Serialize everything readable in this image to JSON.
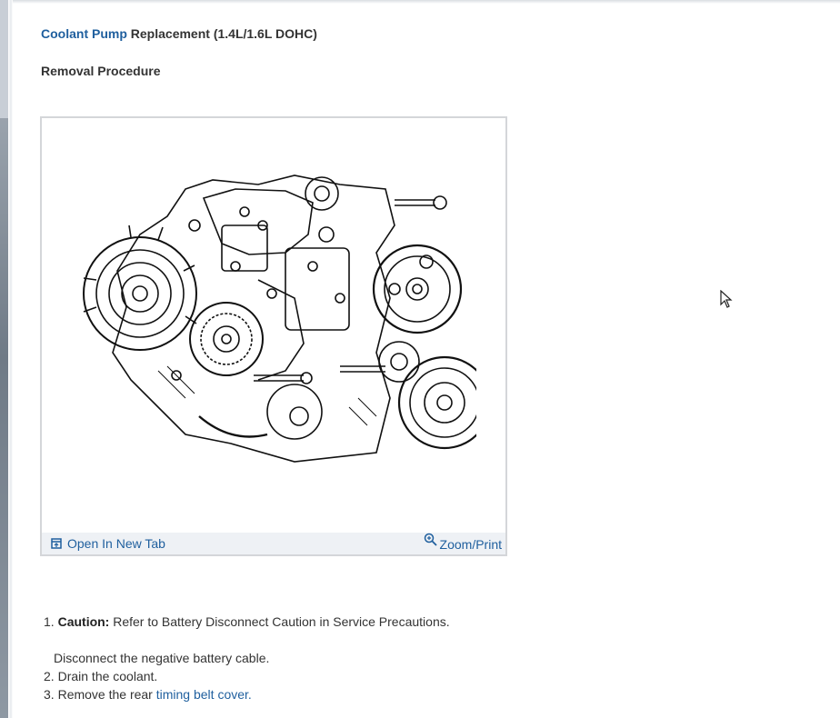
{
  "header": {
    "title_link": "Coolant Pump",
    "title_rest": " Replacement (1.4L/1.6L DOHC)",
    "subtitle": "Removal Procedure"
  },
  "figure": {
    "open_tab_label": "Open In New Tab",
    "zoom_label": "Zoom/Print",
    "icons": [
      "open-new-tab-icon",
      "zoom-icon"
    ]
  },
  "steps": {
    "step1_number": "1.",
    "step1_caution": "Caution:",
    "step1_text": " Refer to Battery Disconnect Caution in Service Precautions.",
    "step1_sub": "Disconnect the negative battery cable.",
    "step2_number": "2.",
    "step2_text": "Drain the coolant.",
    "step3_number": "3.",
    "step3_text": "Remove the rear ",
    "step3_link": "timing belt cover."
  },
  "colors": {
    "link": "#1f5f9e",
    "text": "#333333",
    "figure_bar": "#eef1f5"
  }
}
